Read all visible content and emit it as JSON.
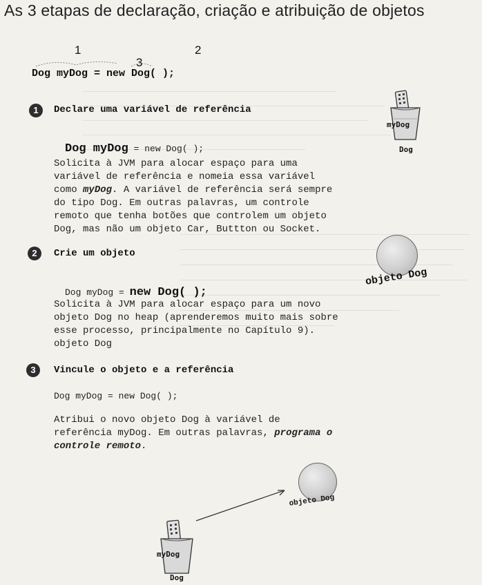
{
  "title": "As 3 etapas de declaração, criação e atribuição de objetos",
  "diagram": {
    "label1": "1",
    "label2": "2",
    "label3": "3",
    "code": "Dog myDog = new Dog( );"
  },
  "step1": {
    "number": "1",
    "heading": "Declare uma variável de referência",
    "code_bold": "Dog myDog",
    "code_rest": " = new Dog( );",
    "para_before": "Solicita à JVM para alocar espaço para uma\nvariável de referência e nomeia essa variável\ncomo ",
    "para_emph": "myDog",
    "para_after": ". A variável de referência será sempre\ndo tipo Dog. Em outras palavras, um controle\nremoto que tenha botões que controlem um objeto\nDog, mas não um objeto Car, Buttton ou Socket.",
    "cup_label": "myDog",
    "cup_type": "Dog"
  },
  "step2": {
    "number": "2",
    "heading": "Crie um objeto",
    "code_rest": "Dog myDog = ",
    "code_bold": "new Dog( );",
    "para": "Solicita à JVM para alocar espaço para um novo\nobjeto Dog no heap (aprenderemos muito mais sobre\nesse processo, principalmente no Capítulo 9).\nobjeto Dog",
    "ball_label": "objeto Dog"
  },
  "step3": {
    "number": "3",
    "heading": "Vincule o objeto e a referência",
    "code": "Dog myDog = new Dog( );",
    "para_before": "Atribui o novo objeto Dog à variável de\nreferência myDog. Em outras palavras, ",
    "para_emph": "programa o\ncontrole remoto",
    "para_after": ".",
    "ball_label": "objeto Dog",
    "cup_label": "myDog",
    "cup_type": "Dog"
  }
}
